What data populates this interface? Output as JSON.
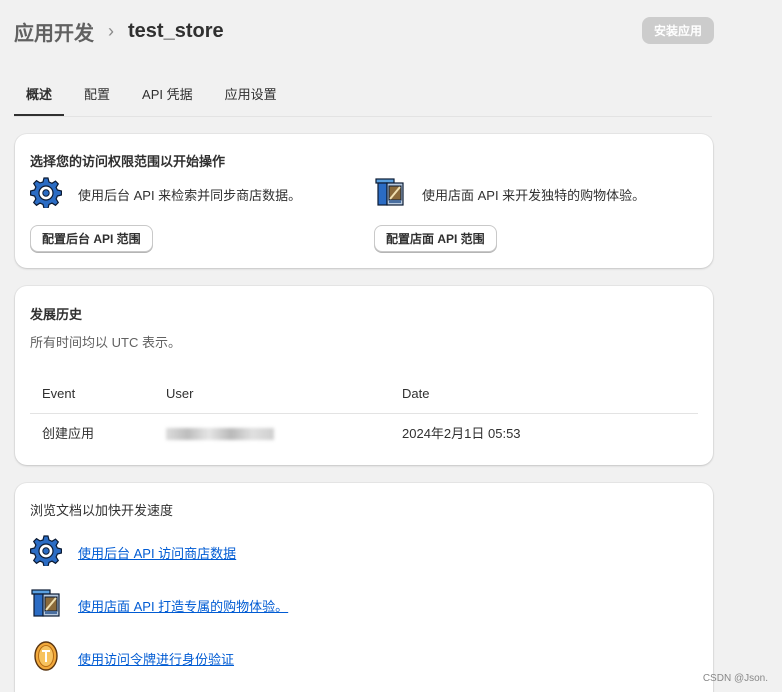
{
  "header": {
    "parent": "应用开发",
    "separator": "›",
    "current": "test_store",
    "install_label": "安装应用"
  },
  "tabs": [
    {
      "label": "概述",
      "active": true
    },
    {
      "label": "配置",
      "active": false
    },
    {
      "label": "API 凭据",
      "active": false
    },
    {
      "label": "应用设置",
      "active": false
    }
  ],
  "scopes": {
    "title": "选择您的访问权限范围以开始操作",
    "admin": {
      "icon": "gear-icon",
      "desc": "使用后台 API 来检索并同步商店数据。",
      "button": "配置后台 API 范围"
    },
    "storefront": {
      "icon": "storefront-icon",
      "desc": "使用店面 API 来开发独特的购物体验。",
      "button": "配置店面 API 范围"
    }
  },
  "history": {
    "title": "发展历史",
    "subtitle": "所有时间均以 UTC 表示。",
    "columns": [
      "Event",
      "User",
      "Date"
    ],
    "rows": [
      {
        "event": "创建应用",
        "user": "",
        "date": "2024年2月1日 05:53"
      }
    ]
  },
  "docs": {
    "title": "浏览文档以加快开发速度",
    "links": [
      {
        "icon": "gear-icon",
        "label": "使用后台 API 访问商店数据"
      },
      {
        "icon": "storefront-icon",
        "label": "使用店面 API 打造专属的购物体验。"
      },
      {
        "icon": "token-icon",
        "label": "使用访问令牌进行身份验证"
      }
    ]
  },
  "watermark": "CSDN @Json.",
  "colors": {
    "link": "#005bd3",
    "disabled_button": "#cccccc",
    "background": "#f1f1f1"
  }
}
